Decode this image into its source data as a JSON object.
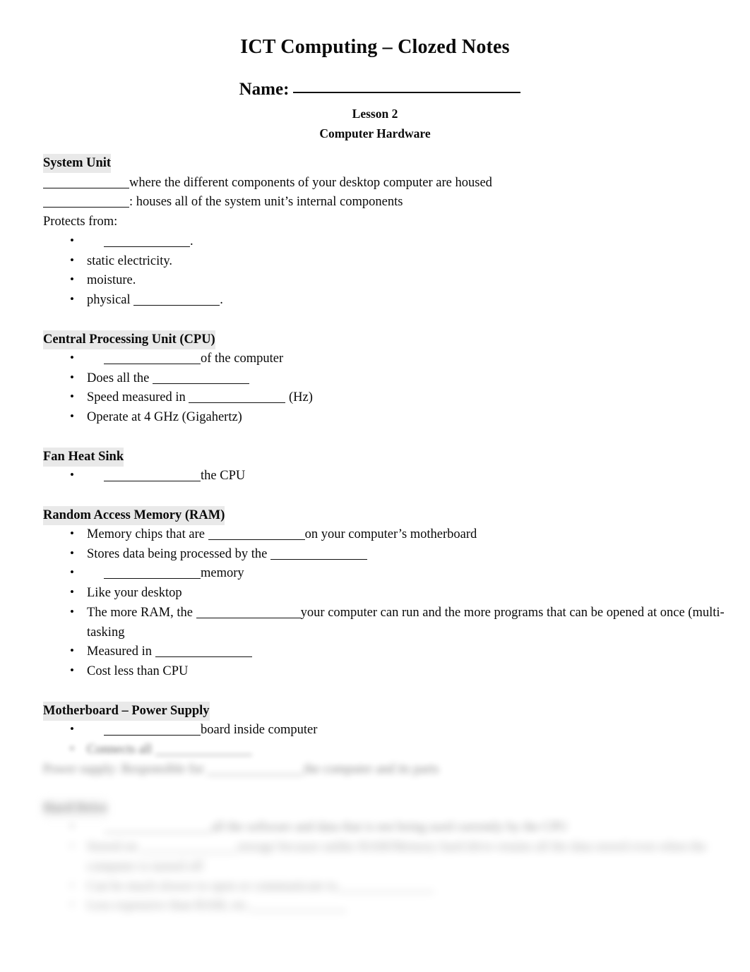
{
  "document": {
    "title": "ICT Computing – Clozed Notes",
    "name_label": "Name:",
    "lesson": "Lesson 2",
    "subject": "Computer Hardware"
  },
  "sections": [
    {
      "heading": "System Unit",
      "lines": [
        {
          "pre": "",
          "post": "where the different components of your desktop computer are housed"
        },
        {
          "pre": "",
          "post": ": houses all of the system unit’s internal components"
        },
        {
          "pre": "Protects from:",
          "post": ""
        }
      ],
      "bullets": [
        {
          "pre": "",
          "post": "."
        },
        {
          "pre": "static electricity.",
          "post": ""
        },
        {
          "pre": "moisture.",
          "post": ""
        },
        {
          "pre": "physical ",
          "post": "."
        }
      ]
    },
    {
      "heading": "Central Processing Unit (CPU)",
      "lines": [],
      "bullets": [
        {
          "pre": "",
          "post": "of the computer"
        },
        {
          "pre": "Does all the ",
          "post": ""
        },
        {
          "pre": "Speed measured in ",
          "post": " (Hz)"
        },
        {
          "pre": "Operate at 4 GHz (Gigahertz)",
          "post": ""
        }
      ]
    },
    {
      "heading": "Fan Heat Sink",
      "lines": [],
      "bullets": [
        {
          "pre": "",
          "post": "the CPU"
        }
      ]
    },
    {
      "heading": "Random Access Memory (RAM)",
      "lines": [],
      "bullets": [
        {
          "pre": "Memory chips that are ",
          "post": "on your computer’s motherboard"
        },
        {
          "pre": "Stores data being processed by the ",
          "post": ""
        },
        {
          "pre": "",
          "post": "memory"
        },
        {
          "pre": "Like your desktop",
          "post": ""
        },
        {
          "pre": "The more RAM, the ",
          "post": "your computer can run and the more programs that can be opened at once (multi-tasking"
        },
        {
          "pre": "Measured in ",
          "post": ""
        },
        {
          "pre": "Cost less than CPU",
          "post": ""
        }
      ]
    },
    {
      "heading": "Motherboard – Power Supply",
      "lines": [],
      "bullets": [
        {
          "pre": "",
          "post": "board inside computer"
        },
        {
          "pre": "Connects all ",
          "post": ""
        }
      ],
      "trailing_line": {
        "pre": "Power supply: Responsible for ",
        "post": "the computer and its parts"
      }
    },
    {
      "heading": "Hard Drive",
      "lines": [],
      "bullets": [
        {
          "pre": "",
          "post": "all the software and data that is not being used currently by the CPU"
        },
        {
          "pre": "Stored on ",
          "post": "storage because unlike RAM/Memory hard drive retains all the data stored even when the computer is turned off"
        },
        {
          "pre": "Can be much slower to open or communicate to",
          "post": ""
        },
        {
          "pre": "Less expensive than RAM, etc.",
          "post": ""
        }
      ]
    }
  ]
}
